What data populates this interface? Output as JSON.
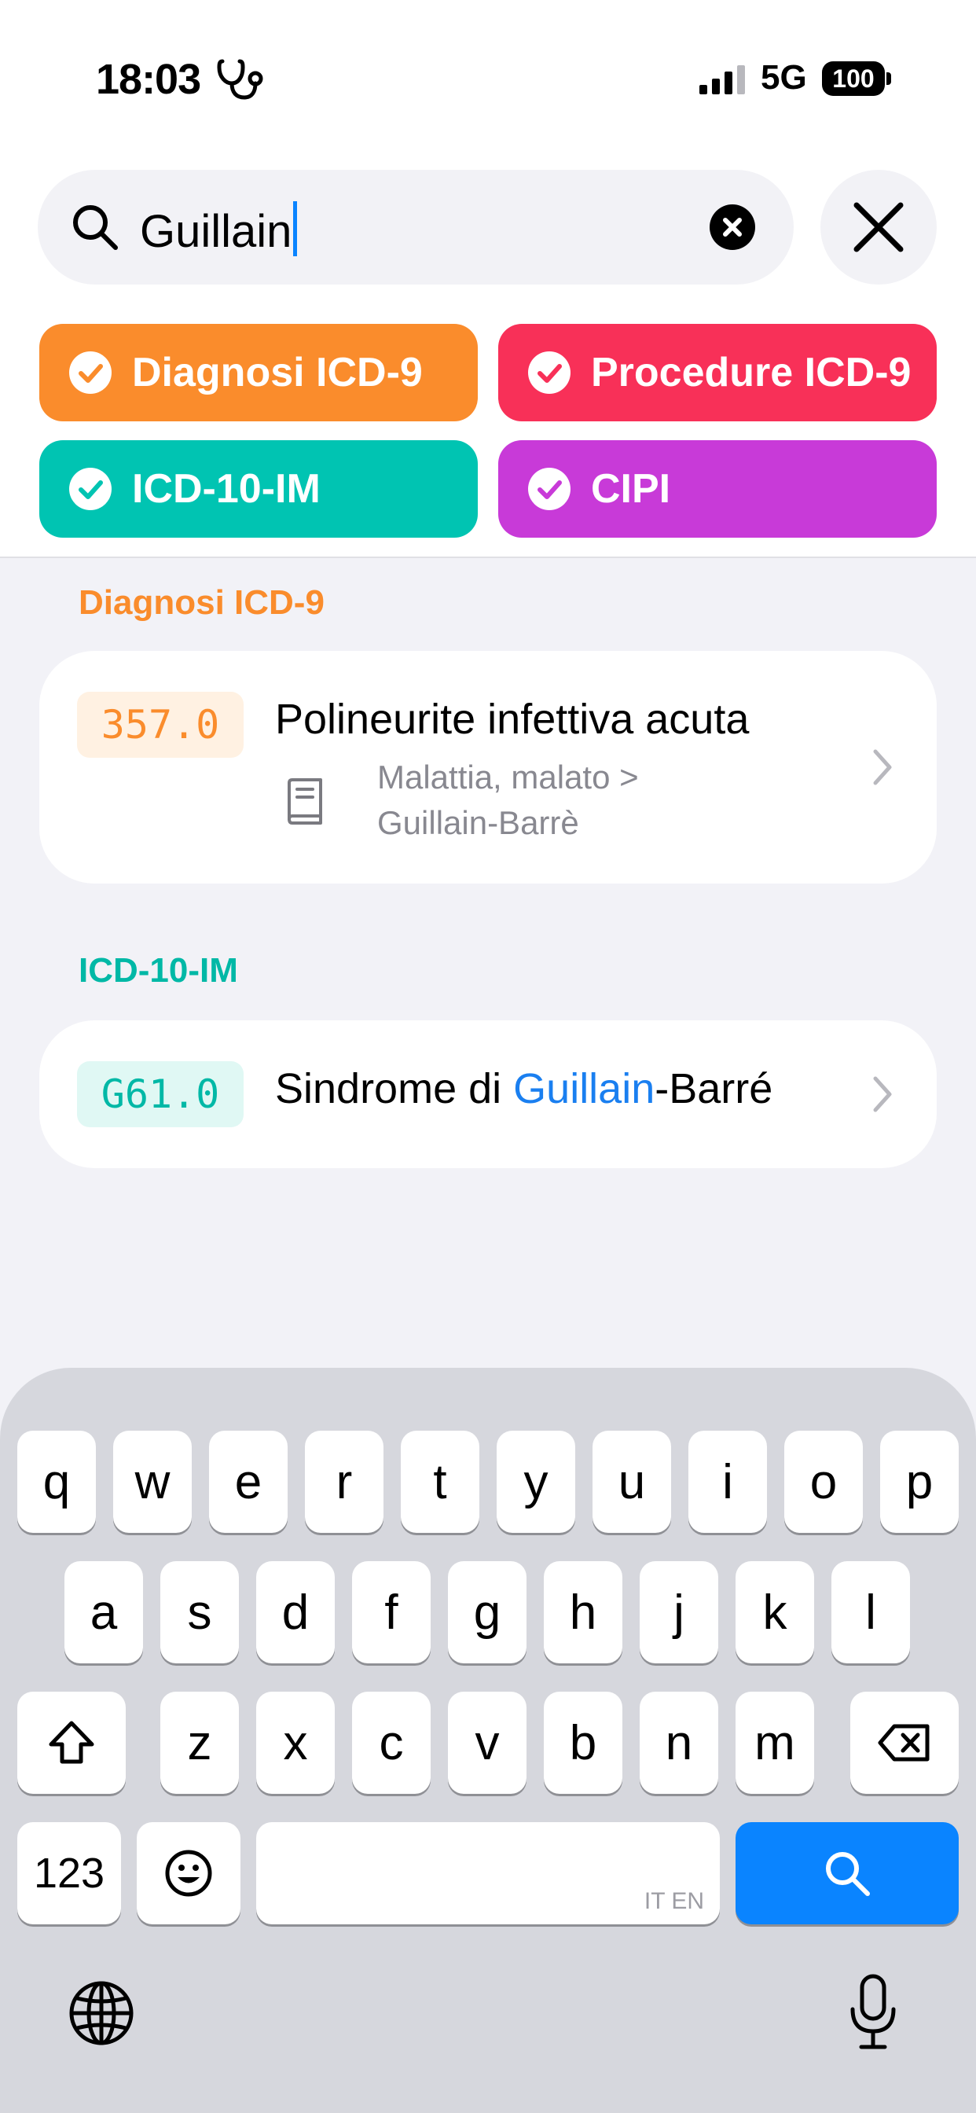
{
  "status_bar": {
    "time": "18:03",
    "network": "5G",
    "battery": "100"
  },
  "search": {
    "query": "Guillain"
  },
  "filters": [
    {
      "label": "Diagnosi ICD-9",
      "color": "#fa8c2c"
    },
    {
      "label": "Procedure ICD-9",
      "color": "#f83058"
    },
    {
      "label": "ICD-10-IM",
      "color": "#00c4b2"
    },
    {
      "label": "CIPI",
      "color": "#c83ad8"
    }
  ],
  "results": [
    {
      "section": "Diagnosi ICD-9",
      "accent": "#fa8c2c",
      "badge_bg": "#fff1e2",
      "code": "357.0",
      "title": "Polineurite infettiva acuta",
      "path_line1": "Malattia, malato >",
      "path_line2": "Guillain-Barrè"
    },
    {
      "section": "ICD-10-IM",
      "accent": "#00b8a6",
      "badge_bg": "#e0f8f4",
      "code": "G61.0",
      "title_pre": "Sindrome di ",
      "title_match": "Guillain",
      "title_post": "-Barré"
    }
  ],
  "keyboard": {
    "row1": [
      "q",
      "w",
      "e",
      "r",
      "t",
      "y",
      "u",
      "i",
      "o",
      "p"
    ],
    "row2": [
      "a",
      "s",
      "d",
      "f",
      "g",
      "h",
      "j",
      "k",
      "l"
    ],
    "row3": [
      "z",
      "x",
      "c",
      "v",
      "b",
      "n",
      "m"
    ],
    "numbers_label": "123",
    "language_hint": "IT EN",
    "accent": "#0a84ff"
  }
}
